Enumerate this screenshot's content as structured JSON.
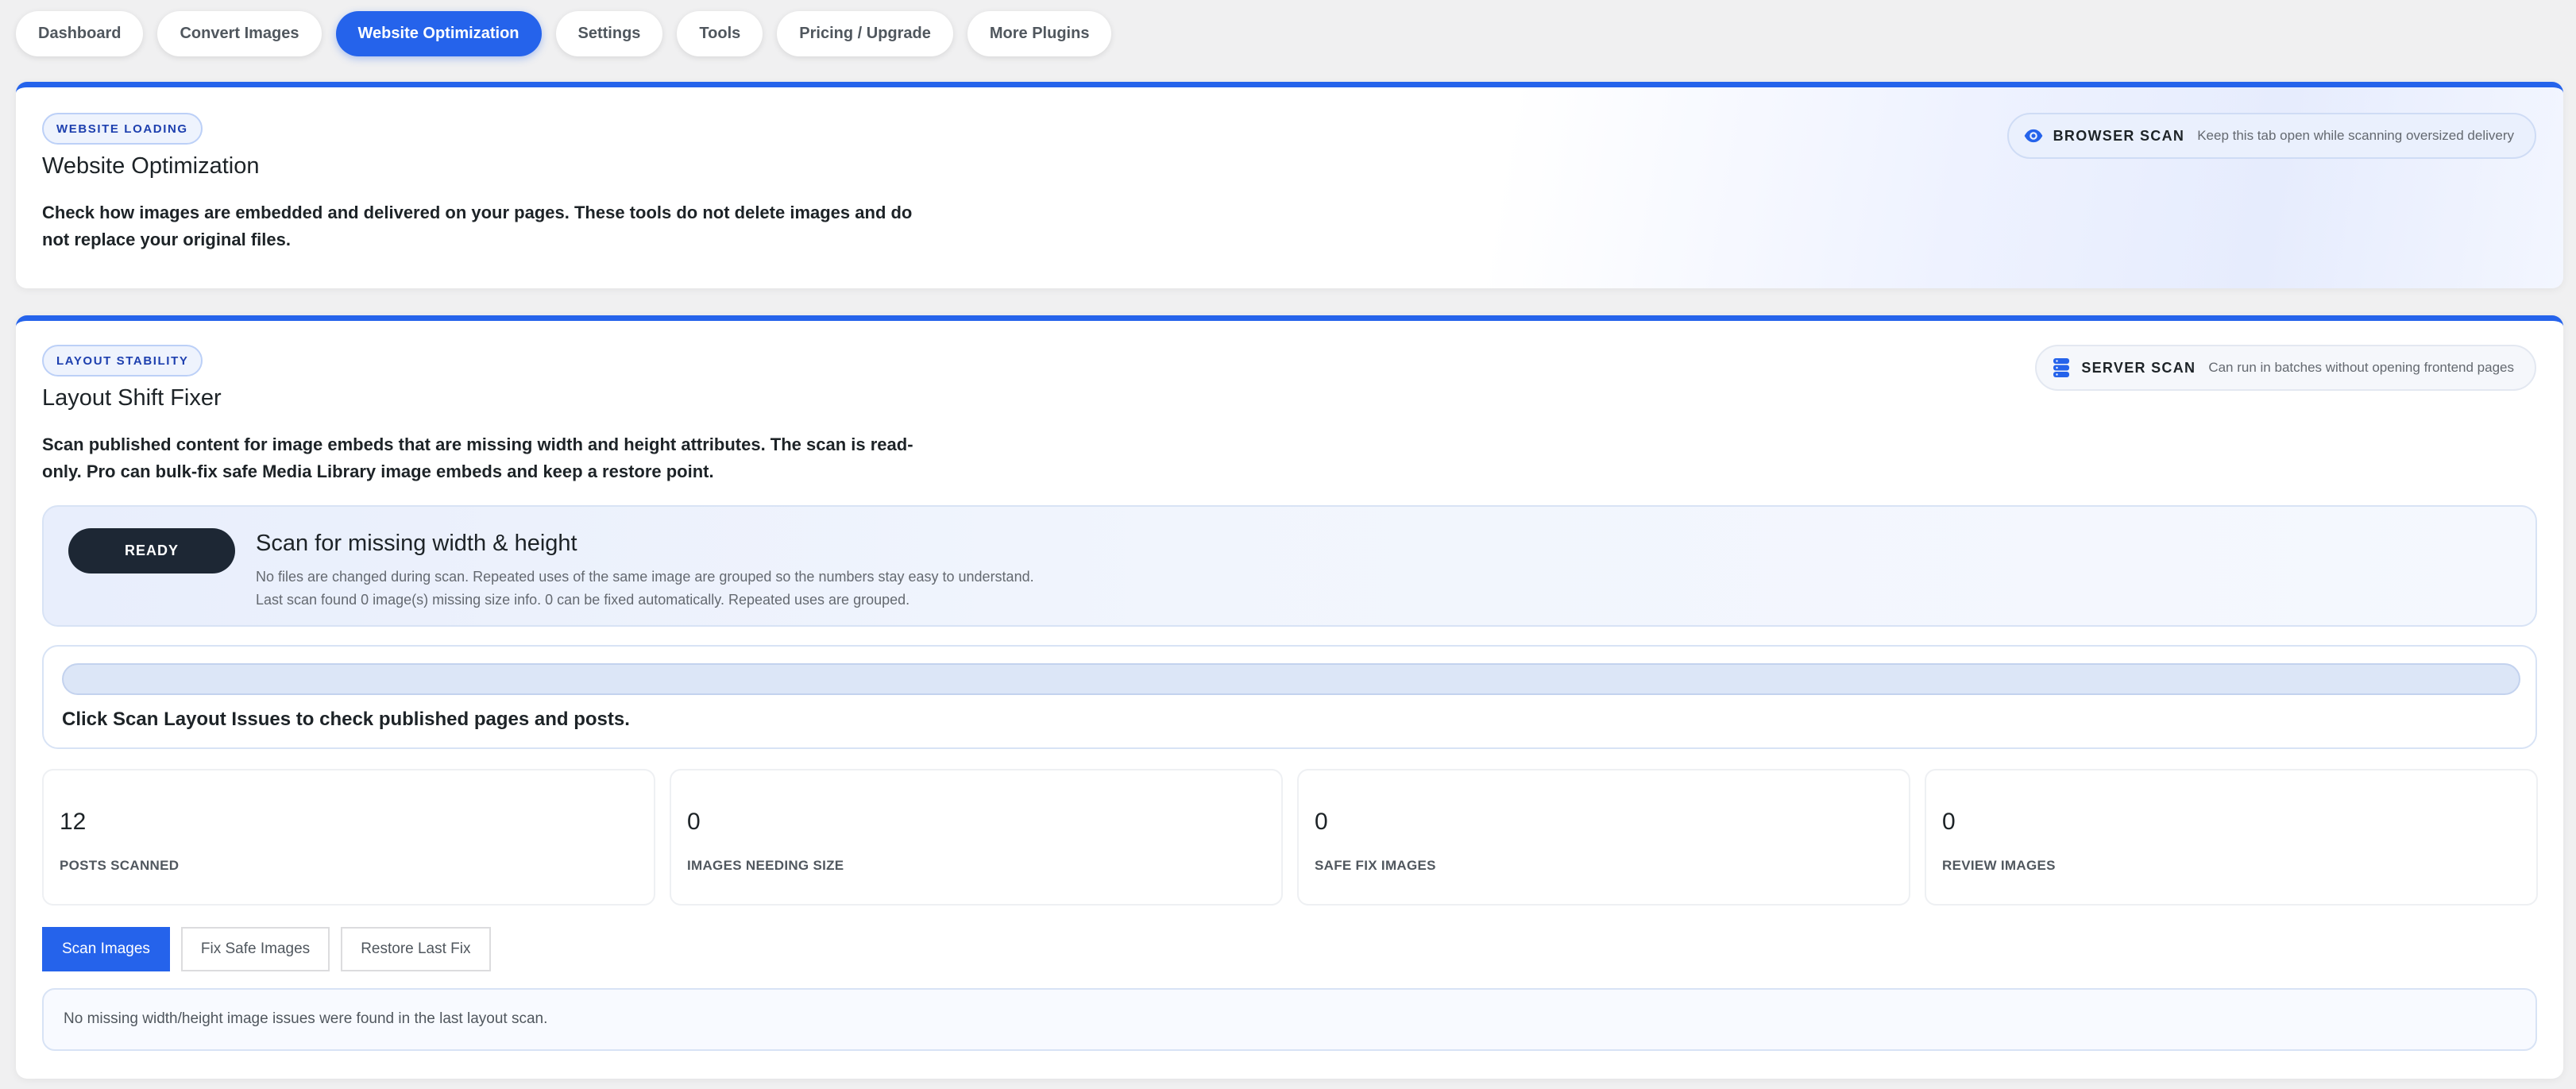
{
  "nav": {
    "tabs": [
      {
        "label": "Dashboard"
      },
      {
        "label": "Convert Images"
      },
      {
        "label": "Website Optimization"
      },
      {
        "label": "Settings"
      },
      {
        "label": "Tools"
      },
      {
        "label": "Pricing / Upgrade"
      },
      {
        "label": "More Plugins"
      }
    ],
    "active": "Website Optimization"
  },
  "website_loading": {
    "tag": "WEBSITE LOADING",
    "title": "Website Optimization",
    "description": "Check how images are embedded and delivered on your pages. These tools do not delete images and do not replace your original files.",
    "badge": {
      "icon": "eye-icon",
      "label": "BROWSER SCAN",
      "note": "Keep this tab open while scanning oversized delivery"
    }
  },
  "layout_stability": {
    "tag": "LAYOUT STABILITY",
    "title": "Layout Shift Fixer",
    "description": "Scan published content for image embeds that are missing width and height attributes. The scan is read-only. Pro can bulk-fix safe Media Library image embeds and keep a restore point.",
    "badge": {
      "icon": "database-icon",
      "label": "SERVER SCAN",
      "note": "Can run in batches without opening frontend pages"
    },
    "status": {
      "state": "READY",
      "title": "Scan for missing width & height",
      "line1": "No files are changed during scan. Repeated uses of the same image are grouped so the numbers stay easy to understand.",
      "line2": "Last scan found 0 image(s) missing size info. 0 can be fixed automatically. Repeated uses are grouped."
    },
    "progress": {
      "percent": 0,
      "message": "Click Scan Layout Issues to check published pages and posts."
    },
    "stats": [
      {
        "value": "12",
        "label": "POSTS SCANNED"
      },
      {
        "value": "0",
        "label": "IMAGES NEEDING SIZE"
      },
      {
        "value": "0",
        "label": "SAFE FIX IMAGES"
      },
      {
        "value": "0",
        "label": "REVIEW IMAGES"
      }
    ],
    "actions": {
      "scan": "Scan Images",
      "fix": "Fix Safe Images",
      "restore": "Restore Last Fix"
    },
    "result": "No missing width/height image issues were found in the last layout scan."
  },
  "colors": {
    "accent": "#2563eb",
    "ready_button": "#1d2734"
  }
}
